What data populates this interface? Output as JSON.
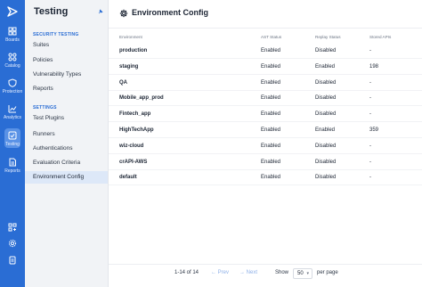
{
  "colors": {
    "rail": "#2a6dd4",
    "accent": "#2a6dd4",
    "active_bg": "#dde8f8"
  },
  "rail": {
    "items": [
      {
        "label": "Boards",
        "icon": "boards-icon"
      },
      {
        "label": "Catalog",
        "icon": "catalog-icon"
      },
      {
        "label": "Protection",
        "icon": "shield-icon"
      },
      {
        "label": "Analytics",
        "icon": "analytics-icon"
      },
      {
        "label": "Testing",
        "icon": "testing-icon"
      },
      {
        "label": "Reports",
        "icon": "reports-icon"
      }
    ],
    "bottom_icons": [
      "apps-icon",
      "gear-icon",
      "document-icon"
    ]
  },
  "sidebar": {
    "title": "Testing",
    "section1": "SECURITY TESTING",
    "items1": [
      "Suites",
      "Policies",
      "Vulnerability Types",
      "Reports"
    ],
    "section2": "SETTINGS",
    "items2": [
      "Test Plugins",
      "Runners",
      "Authentications",
      "Evaluation Criteria",
      "Environment Config"
    ],
    "active": "Environment Config"
  },
  "page": {
    "title": "Environment Config"
  },
  "table": {
    "headers": [
      "Environment",
      "AST Status",
      "Replay Status",
      "Stored APIs"
    ],
    "rows": [
      [
        "production",
        "Enabled",
        "Disabled",
        "-"
      ],
      [
        "staging",
        "Enabled",
        "Enabled",
        "198"
      ],
      [
        "QA",
        "Enabled",
        "Disabled",
        "-"
      ],
      [
        "Mobile_app_prod",
        "Enabled",
        "Disabled",
        "-"
      ],
      [
        "Fintech_app",
        "Enabled",
        "Disabled",
        "-"
      ],
      [
        "HighTechApp",
        "Enabled",
        "Enabled",
        "359"
      ],
      [
        "wiz-cloud",
        "Enabled",
        "Disabled",
        "-"
      ],
      [
        "crAPI-AWS",
        "Enabled",
        "Disabled",
        "-"
      ],
      [
        "default",
        "Enabled",
        "Disabled",
        "-"
      ]
    ]
  },
  "pagination": {
    "range": "1-14 of 14",
    "prev": "← Prev",
    "next": "→ Next",
    "show": "Show",
    "per_page_value": "50",
    "per_page_label": "per page"
  }
}
